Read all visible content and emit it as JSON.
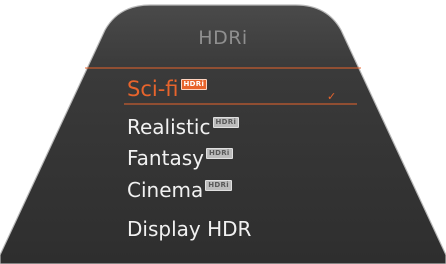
{
  "header": {
    "title": "HDRi"
  },
  "menu": {
    "items": [
      {
        "label": "Sci-fi",
        "badge": "HDRi",
        "selected": true
      },
      {
        "label": "Realistic",
        "badge": "HDRi",
        "selected": false
      },
      {
        "label": "Fantasy",
        "badge": "HDRi",
        "selected": false
      },
      {
        "label": "Cinema",
        "badge": "HDRi",
        "selected": false
      },
      {
        "label": "Display HDR",
        "badge": "",
        "selected": false
      }
    ],
    "check_mark": "✓"
  },
  "colors": {
    "accent": "#e8642c",
    "panel_bg": "#3a3a3a",
    "panel_border": "#b0b0b0",
    "text": "#f1f1f1",
    "title_text": "#8f8f8f"
  },
  "icons": {
    "badge": "hdri-badge-icon",
    "check": "checkmark-icon"
  }
}
